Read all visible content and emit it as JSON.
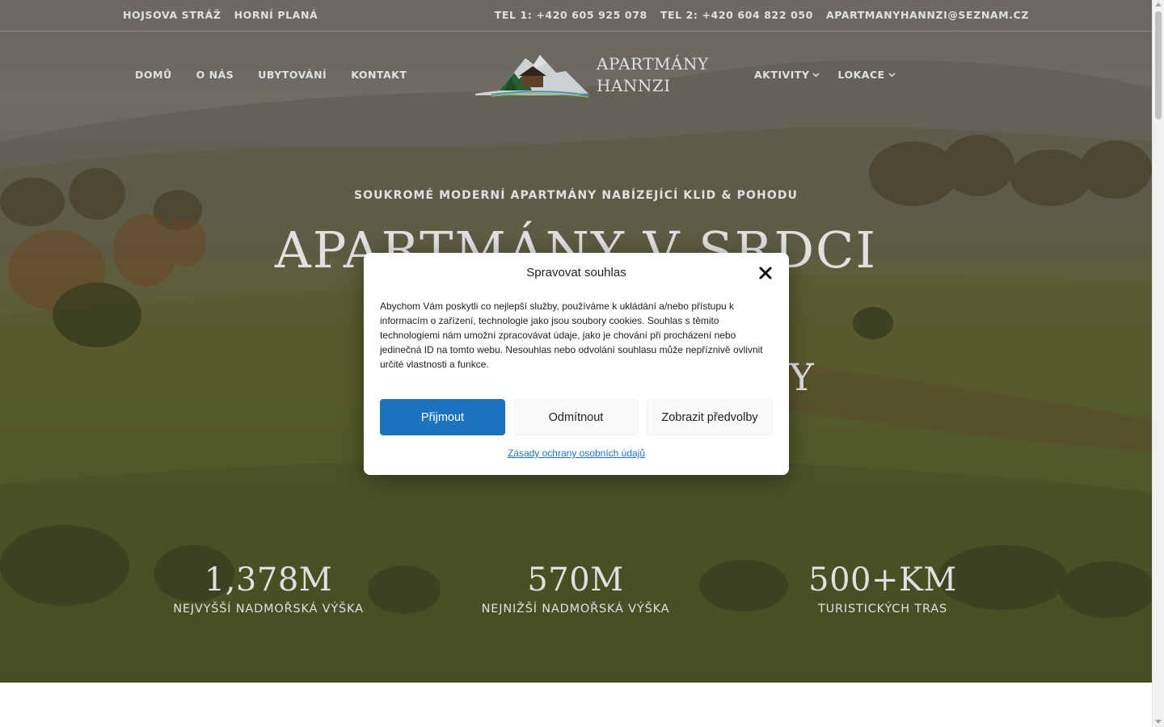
{
  "topbar": {
    "left_links": [
      "HOJSOVA STRÁŽ",
      "HORNÍ PLANÁ"
    ],
    "phone1": "TEL 1: +420 605 925 078",
    "phone2": "TEL 2: +420 604 822 050",
    "email": "APARTMANYHANNZI@SEZNAM.CZ"
  },
  "nav": {
    "home": "DOMŮ",
    "about": "O NÁS",
    "accommodation": "UBYTOVÁNÍ",
    "contact": "KONTAKT",
    "activities": "AKTIVITY",
    "locations": "LOKACE"
  },
  "logo": {
    "line1": "APARTMÁNY",
    "line2": "HANNZI"
  },
  "hero": {
    "eyebrow": "SOUKROMÉ MODERNÍ APARTMÁNY NABÍZEJÍCÍ KLID & POHODU",
    "headline": "APARTMÁNY V SRDCI",
    "headline_2_visible": "Y"
  },
  "stats": [
    {
      "value": "1,378M",
      "label": "NEJVYŠŠÍ NADMOŘSKÁ VÝŠKA"
    },
    {
      "value": "570M",
      "label": "NEJNIŽŠÍ NADMOŘSKÁ VÝŠKA"
    },
    {
      "value": "500+KM",
      "label": "TURISTICKÝCH TRAS"
    }
  ],
  "cookie": {
    "title": "Spravovat souhlas",
    "body": "Abychom Vám poskytli co nejlepší služby, používáme k ukládání a/nebo přístupu k informacím o zařízení, technologie jako jsou soubory cookies. Souhlas s těmito technologiemi nám umožní zpracovávat údaje, jako je chování při procházení nebo jedinečná ID na tomto webu. Nesouhlas nebo odvolání souhlasu může nepříznivě ovlivnit určité vlastnosti a funkce.",
    "accept": "Přijmout",
    "deny": "Odmítnout",
    "preferences": "Zobrazit předvolby",
    "policy_link": "Zásady ochrany osobních údajů"
  },
  "colors": {
    "primary_button": "#1e73be",
    "link": "#1e73be"
  }
}
